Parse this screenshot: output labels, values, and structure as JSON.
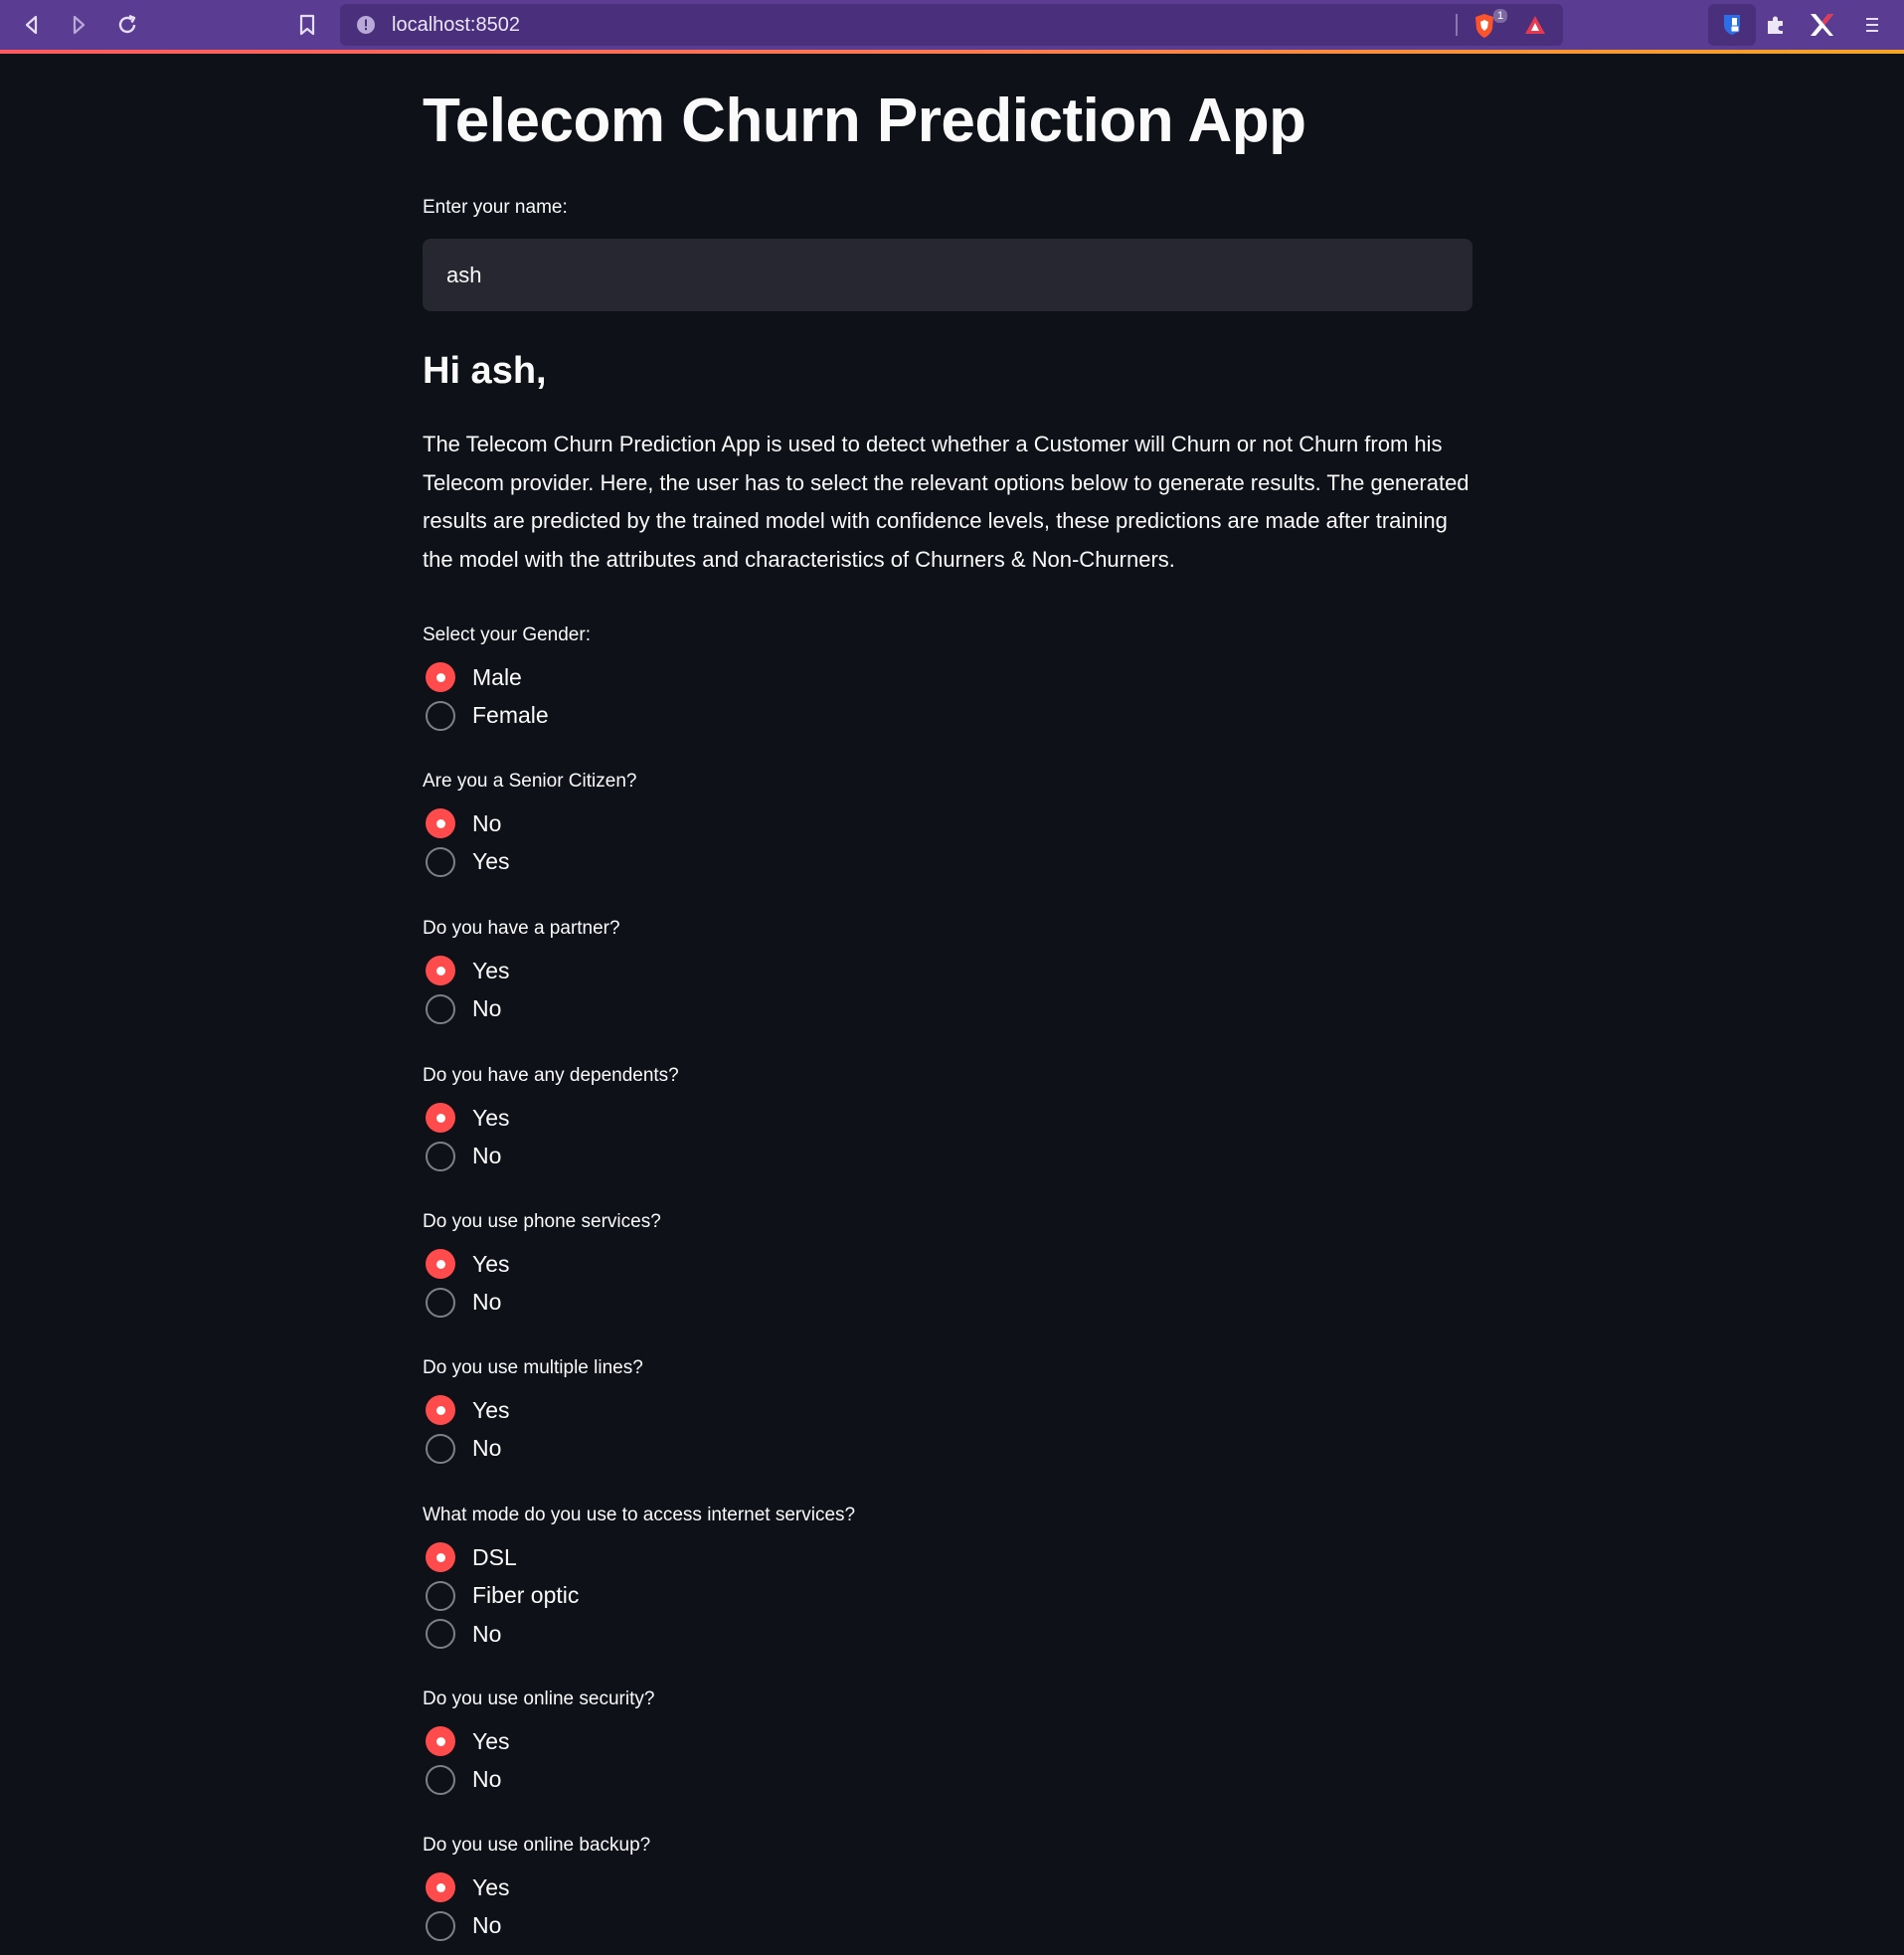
{
  "browser": {
    "url": "localhost:8502",
    "brave_badge": "1"
  },
  "app": {
    "title": "Telecom Churn Prediction App",
    "name_label": "Enter your name:",
    "name_value": "ash",
    "greeting": "Hi ash,",
    "description": "The Telecom Churn Prediction App is used to detect whether a Customer will Churn or not Churn from his Telecom provider. Here, the user has to select the relevant options below to generate results. The generated results are predicted by the trained model with confidence levels, these predictions are made after training the model with the attributes and characteristics of Churners & Non-Churners."
  },
  "questions": [
    {
      "label": "Select your Gender:",
      "options": [
        "Male",
        "Female"
      ],
      "selected": 0
    },
    {
      "label": "Are you a Senior Citizen?",
      "options": [
        "No",
        "Yes"
      ],
      "selected": 0
    },
    {
      "label": "Do you have a partner?",
      "options": [
        "Yes",
        "No"
      ],
      "selected": 0
    },
    {
      "label": "Do you have any dependents?",
      "options": [
        "Yes",
        "No"
      ],
      "selected": 0
    },
    {
      "label": "Do you use phone services?",
      "options": [
        "Yes",
        "No"
      ],
      "selected": 0
    },
    {
      "label": "Do you use multiple lines?",
      "options": [
        "Yes",
        "No"
      ],
      "selected": 0
    },
    {
      "label": "What mode do you use to access internet services?",
      "options": [
        "DSL",
        "Fiber optic",
        "No"
      ],
      "selected": 0
    },
    {
      "label": "Do you use online security?",
      "options": [
        "Yes",
        "No"
      ],
      "selected": 0
    },
    {
      "label": "Do you use online backup?",
      "options": [
        "Yes",
        "No"
      ],
      "selected": 0
    }
  ],
  "colors": {
    "accent": "#ff4b4b",
    "background": "#0e1117",
    "input_bg": "#262730",
    "browser_bar": "#5b3c93"
  }
}
